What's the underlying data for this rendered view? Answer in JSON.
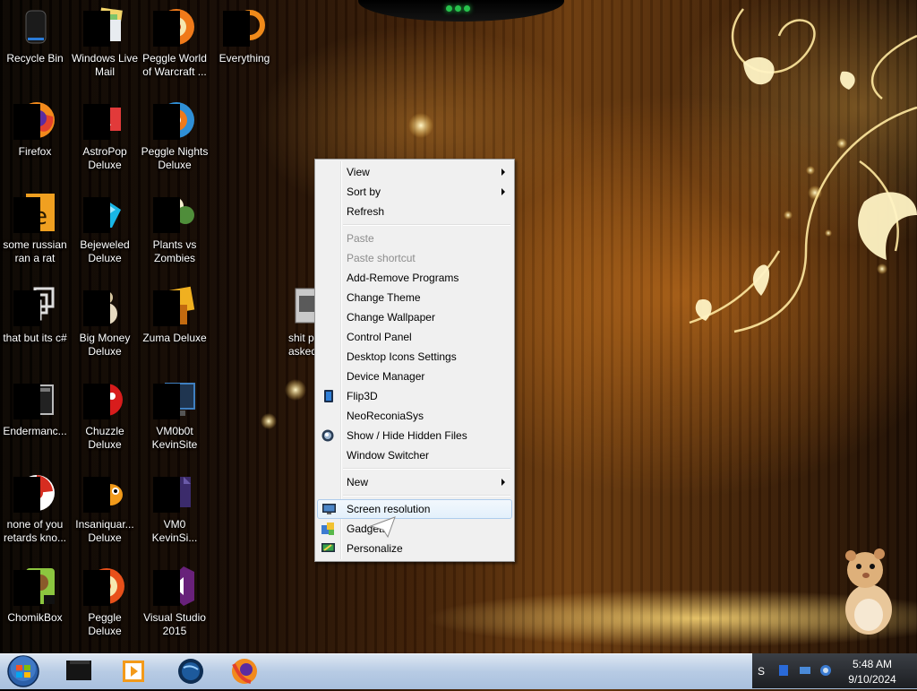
{
  "desktop_icons": [
    {
      "label": "Recycle Bin",
      "icon": "recycle-bin-icon"
    },
    {
      "label": "Windows Live Mail",
      "icon": "windows-live-mail-icon"
    },
    {
      "label": "Peggle World of Warcraft ...",
      "icon": "peggle-world-of-warcraft-icon"
    },
    {
      "label": "Everything",
      "icon": "everything-search-icon"
    },
    {
      "label": "Firefox",
      "icon": "firefox-icon"
    },
    {
      "label": "AstroPop Deluxe",
      "icon": "astropop-icon"
    },
    {
      "label": "Peggle Nights Deluxe",
      "icon": "peggle-nights-icon"
    },
    {
      "label": "some russian ran a rat",
      "icon": "folder-e-icon"
    },
    {
      "label": "Bejeweled Deluxe",
      "icon": "bejeweled-icon"
    },
    {
      "label": "Plants vs Zombies",
      "icon": "plants-vs-zombies-icon"
    },
    {
      "label": "that but its c#",
      "icon": "shortcut-stack-icon"
    },
    {
      "label": "Big Money Deluxe",
      "icon": "big-money-icon"
    },
    {
      "label": "Zuma Deluxe",
      "icon": "zuma-icon"
    },
    {
      "label": "Endermanc...",
      "icon": "terminal-icon"
    },
    {
      "label": "Chuzzle Deluxe",
      "icon": "chuzzle-icon"
    },
    {
      "label": "VM0b0t KevinSite",
      "icon": "vm-monitor-icon"
    },
    {
      "label": "none of you retards kno...",
      "icon": "chrome-like-icon"
    },
    {
      "label": "Insaniquar... Deluxe",
      "icon": "insaniquarium-icon"
    },
    {
      "label": "VM0 KevinSi...",
      "icon": "vm-document-icon"
    },
    {
      "label": "ChomikBox",
      "icon": "chomikbox-icon"
    },
    {
      "label": "Peggle Deluxe",
      "icon": "peggle-deluxe-icon"
    },
    {
      "label": "Visual Studio 2015",
      "icon": "visual-studio-icon"
    },
    {
      "label": "shit p asked",
      "icon": "shortcut-icon"
    }
  ],
  "context_menu": {
    "items": [
      {
        "label": "View",
        "submenu": true
      },
      {
        "label": "Sort by",
        "submenu": true
      },
      {
        "label": "Refresh"
      },
      {
        "label": "Paste",
        "disabled": true
      },
      {
        "label": "Paste shortcut",
        "disabled": true
      },
      {
        "label": "Add-Remove Programs"
      },
      {
        "label": "Change Theme"
      },
      {
        "label": "Change Wallpaper"
      },
      {
        "label": "Control Panel"
      },
      {
        "label": "Desktop Icons Settings"
      },
      {
        "label": "Device Manager"
      },
      {
        "label": "Flip3D",
        "icon": "flip3d-icon"
      },
      {
        "label": "NeoReconiaSys"
      },
      {
        "label": "Show / Hide Hidden Files",
        "icon": "globe-icon"
      },
      {
        "label": "Window Switcher"
      },
      {
        "label": "New",
        "submenu": true
      },
      {
        "label": "Screen resolution",
        "icon": "display-icon",
        "highlighted": true
      },
      {
        "label": "Gadgets",
        "icon": "gadgets-icon"
      },
      {
        "label": "Personalize",
        "icon": "personalize-icon"
      }
    ]
  },
  "taskbar": {
    "start_icon": "windows-orb-icon",
    "pinned": [
      "media-center-icon",
      "media-player-icon",
      "globe-app-icon",
      "firefox-icon"
    ],
    "clock": {
      "time": "5:48 AM",
      "date": "9/10/2024"
    },
    "tray_fragment": "S"
  },
  "colors": {
    "menu_bg": "#f0f0f0",
    "highlight_border": "#aeccec",
    "taskbar": "#b7cbe4",
    "disabled_text": "#8d8d8d"
  }
}
